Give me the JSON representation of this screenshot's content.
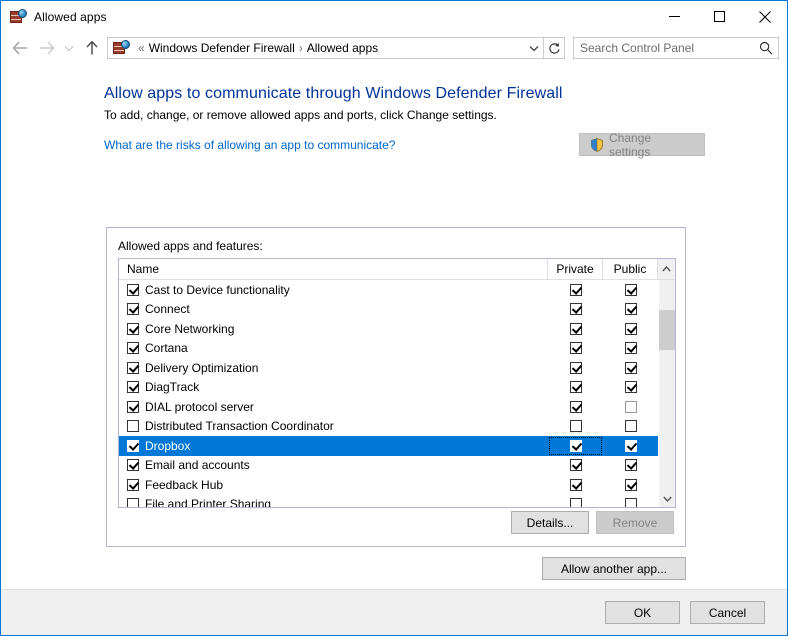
{
  "window": {
    "title": "Allowed apps",
    "icon": "firewall-icon",
    "minimize_label": "Minimize",
    "maximize_label": "Maximize",
    "close_label": "Close"
  },
  "nav": {
    "back_label": "Back",
    "forward_label": "Forward",
    "recent_label": "Recent locations",
    "up_label": "Up one level",
    "breadcrumb": {
      "overflow": "«",
      "separator": "›",
      "items": [
        "Windows Defender Firewall",
        "Allowed apps"
      ]
    },
    "dropdown_label": "Previous locations",
    "refresh_label": "Refresh",
    "search": {
      "placeholder": "Search Control Panel",
      "value": ""
    }
  },
  "page": {
    "title": "Allow apps to communicate through Windows Defender Firewall",
    "subtitle": "To add, change, or remove allowed apps and ports, click Change settings.",
    "risk_link": "What are the risks of allowing an app to communicate?",
    "change_settings_label": "Change settings",
    "change_settings_enabled": false
  },
  "group": {
    "label": "Allowed apps and features:",
    "columns": [
      "Name",
      "Private",
      "Public"
    ],
    "rows": [
      {
        "name": "Cast to Device functionality",
        "enabled": true,
        "private": true,
        "public": true,
        "selected": false
      },
      {
        "name": "Connect",
        "enabled": true,
        "private": true,
        "public": true,
        "selected": false
      },
      {
        "name": "Core Networking",
        "enabled": true,
        "private": true,
        "public": true,
        "selected": false
      },
      {
        "name": "Cortana",
        "enabled": true,
        "private": true,
        "public": true,
        "selected": false
      },
      {
        "name": "Delivery Optimization",
        "enabled": true,
        "private": true,
        "public": true,
        "selected": false
      },
      {
        "name": "DiagTrack",
        "enabled": true,
        "private": true,
        "public": true,
        "selected": false
      },
      {
        "name": "DIAL protocol server",
        "enabled": true,
        "private": true,
        "public": false,
        "public_grey": true,
        "selected": false
      },
      {
        "name": "Distributed Transaction Coordinator",
        "enabled": false,
        "private": false,
        "public": false,
        "selected": false
      },
      {
        "name": "Dropbox",
        "enabled": true,
        "private": true,
        "public": true,
        "selected": true,
        "private_focused": true
      },
      {
        "name": "Email and accounts",
        "enabled": true,
        "private": true,
        "public": true,
        "selected": false
      },
      {
        "name": "Feedback Hub",
        "enabled": true,
        "private": true,
        "public": true,
        "selected": false
      },
      {
        "name": "File and Printer Sharing",
        "enabled": false,
        "private": false,
        "public": false,
        "selected": false
      }
    ],
    "details_label": "Details...",
    "details_enabled": true,
    "remove_label": "Remove",
    "remove_enabled": false
  },
  "actions": {
    "allow_another_label": "Allow another app...",
    "ok_label": "OK",
    "cancel_label": "Cancel"
  },
  "colors": {
    "selection": "#0078d7",
    "title_link": "#003399",
    "link": "#0066cc",
    "window_border": "#0078d7"
  }
}
